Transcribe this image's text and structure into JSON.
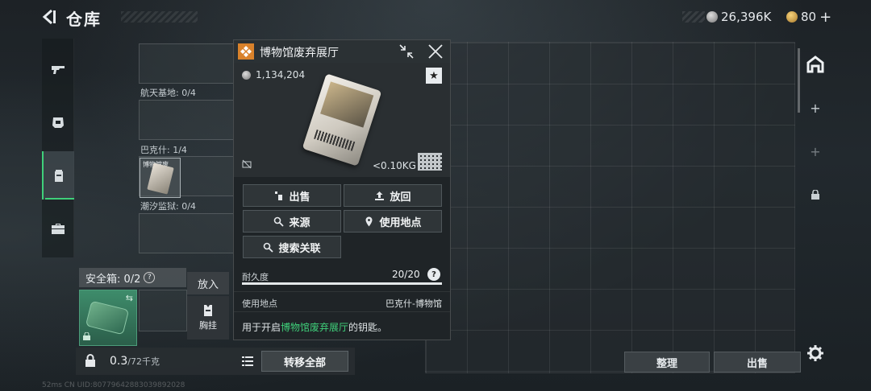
{
  "header": {
    "title": "仓库",
    "currency_silver": "26,396K",
    "currency_gold": "80",
    "plus": "+"
  },
  "storage": {
    "slots": [
      {
        "label": "航天基地: 0/4"
      },
      {
        "label": "巴克什: 1/4"
      },
      {
        "label": "潮汐监狱: 0/4"
      }
    ],
    "key_item_name": "博物馆废"
  },
  "safe_box": {
    "label": "安全箱: 0/2",
    "help": "?",
    "swap_glyph": "⇆",
    "put_label": "放入",
    "chest_label": "胸挂"
  },
  "bottom_bar": {
    "weight": "0.3",
    "capacity": "/72千克",
    "transfer_all": "转移全部"
  },
  "status_line": "52ms  CN UID:80779642883039892028",
  "actions": {
    "sort": "整理",
    "sell": "出售"
  },
  "panel": {
    "title": "博物馆废弃展厅",
    "price": "1,134,204",
    "weight": "<0.10KG",
    "star": "★",
    "buttons": {
      "sell": "出售",
      "return": "放回",
      "source": "来源",
      "use_location": "使用地点",
      "search_related": "搜索关联"
    },
    "durability_label": "耐久度",
    "durability_value": "20/20",
    "durability_fraction": 1.0,
    "use_location_label": "使用地点",
    "use_location_value": "巴克什-博物馆",
    "description_prefix": "用于开启",
    "description_highlight": "博物馆废弃展厅",
    "description_suffix": "的钥匙。"
  },
  "colors": {
    "accent_green": "#3fd07a"
  },
  "icons": [
    "back-arrow-icon",
    "silver-coin-icon",
    "gold-coin-icon",
    "gun-icon",
    "helmet-icon",
    "backpack-icon",
    "briefcase-icon",
    "lock-icon",
    "list-icon",
    "gear-icon",
    "shrink-icon",
    "close-icon",
    "star-icon",
    "sell-icon",
    "upload-icon",
    "search-icon",
    "pin-icon",
    "no-bind-icon"
  ]
}
